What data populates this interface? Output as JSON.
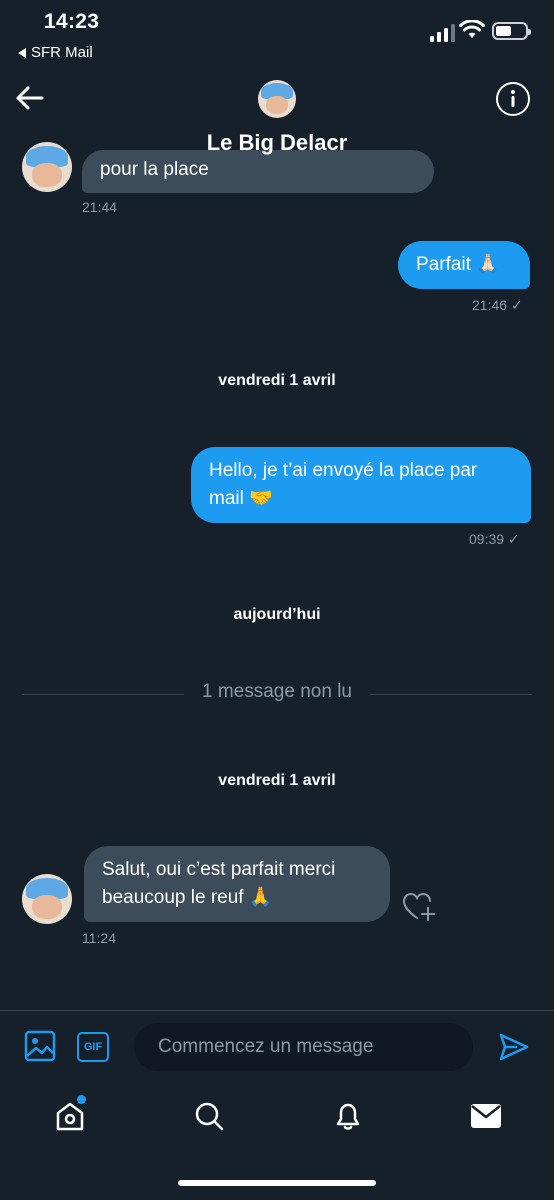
{
  "status_bar": {
    "time": "14:23",
    "back_app": "SFR Mail"
  },
  "header": {
    "title": "Le Big Delacr"
  },
  "messages": [
    {
      "dir": "in",
      "text": "pour la place",
      "time": "21:44"
    },
    {
      "dir": "out",
      "text": "Parfait 🙏🏻",
      "time": "21:46 ✓"
    },
    {
      "type": "day",
      "text": "vendredi 1 avril"
    },
    {
      "dir": "out",
      "text": "Hello, je t’ai envoyé la place par mail 🤝",
      "line1": "Hello, je t’ai envoyé la place par",
      "line2": "mail 🤝",
      "time": "09:39 ✓"
    },
    {
      "type": "day",
      "text": "aujourd’hui"
    },
    {
      "type": "unread",
      "text": "1 message non lu"
    },
    {
      "type": "day",
      "text": "vendredi 1 avril"
    },
    {
      "dir": "in",
      "text": "Salut, oui c’est parfait merci beaucoup le reuf 🙏",
      "line1": "Salut, oui c’est parfait merci",
      "line2": "beaucoup le reuf 🙏",
      "time": "11:24"
    }
  ],
  "composer": {
    "placeholder": "Commencez un message",
    "gif_label": "GIF"
  },
  "colors": {
    "background": "#15202b",
    "accent": "#1d9bf0",
    "incoming_bubble": "#3d4c5a"
  },
  "icons": [
    "back-arrow-icon",
    "info-icon",
    "image-icon",
    "gif-icon",
    "send-icon",
    "home-icon",
    "search-icon",
    "bell-icon",
    "mail-icon",
    "heart-add-icon"
  ]
}
